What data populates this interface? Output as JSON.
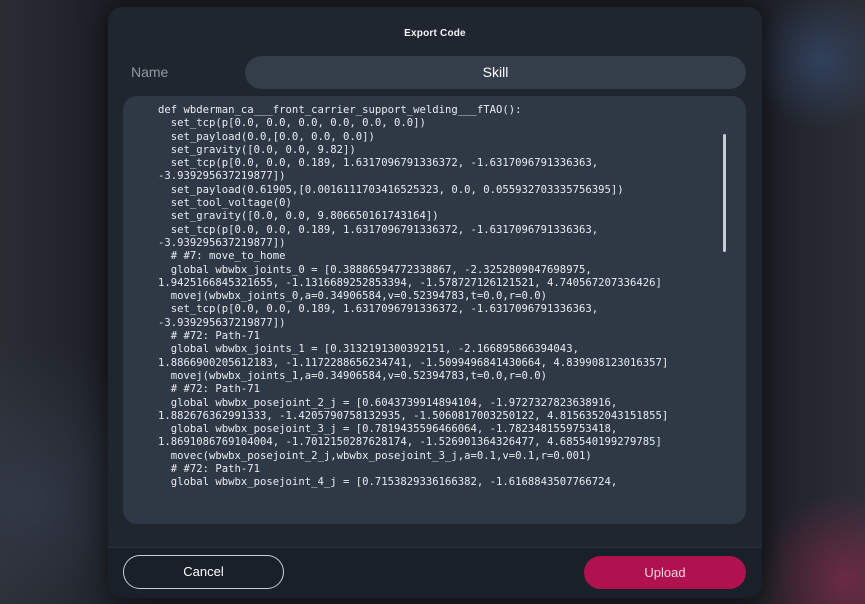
{
  "dialog": {
    "title": "Export Code"
  },
  "name_field": {
    "label": "Name",
    "value": "Skill"
  },
  "code": {
    "lines": [
      "def wbderman_ca___front_carrier_support_welding___fTAO():",
      "  set_tcp(p[0.0, 0.0, 0.0, 0.0, 0.0, 0.0])",
      "  set_payload(0.0,[0.0, 0.0, 0.0])",
      "  set_gravity([0.0, 0.0, 9.82])",
      "  set_tcp(p[0.0, 0.0, 0.189, 1.6317096791336372, -1.6317096791336363,",
      "-3.939295637219877])",
      "  set_payload(0.61905,[0.0016111703416525323, 0.0, 0.055932703335756395])",
      "  set_tool_voltage(0)",
      "  set_gravity([0.0, 0.0, 9.806650161743164])",
      "  set_tcp(p[0.0, 0.0, 0.189, 1.6317096791336372, -1.6317096791336363,",
      "-3.939295637219877])",
      "  # #7: move_to_home",
      "  global wbwbx_joints_0 = [0.38886594772338867, -2.3252809047698975,",
      "1.9425166845321655, -1.1316689252853394, -1.578727126121521, 4.740567207336426]",
      "  movej(wbwbx_joints_0,a=0.34906584,v=0.52394783,t=0.0,r=0.0)",
      "  set_tcp(p[0.0, 0.0, 0.189, 1.6317096791336372, -1.6317096791336363,",
      "-3.939295637219877])",
      "  # #72: Path-71",
      "  global wbwbx_joints_1 = [0.3132191300392151, -2.166895866394043,",
      "1.8866900205612183, -1.1172288656234741, -1.5099496841430664, 4.839908123016357]",
      "  movej(wbwbx_joints_1,a=0.34906584,v=0.52394783,t=0.0,r=0.0)",
      "  # #72: Path-71",
      "  global wbwbx_posejoint_2_j = [0.6043739914894104, -1.9727327823638916,",
      "1.882676362991333, -1.4205790758132935, -1.5060817003250122, 4.8156352043151855]",
      "  global wbwbx_posejoint_3_j = [0.7819435596466064, -1.7823481559753418,",
      "1.8691086769104004, -1.7012150287628174, -1.526901364326477, 4.685540199279785]",
      "  movec(wbwbx_posejoint_2_j,wbwbx_posejoint_3_j,a=0.1,v=0.1,r=0.001)",
      "  # #72: Path-71",
      "  global wbwbx_posejoint_4_j = [0.7153829336166382, -1.6168843507766724,"
    ]
  },
  "buttons": {
    "cancel": "Cancel",
    "upload": "Upload"
  },
  "colors": {
    "upload_accent": "#b0124f",
    "panel": "#2f3845",
    "modal": "#1f2630"
  }
}
